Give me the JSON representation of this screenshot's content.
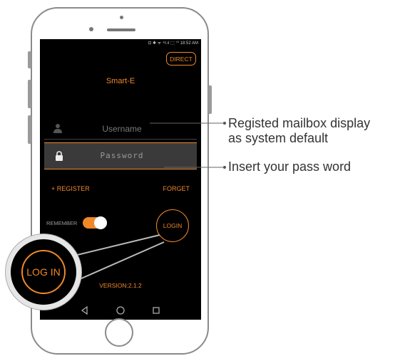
{
  "statusbar": {
    "text": "⊡ ✱ ᯤ ⁴ᵍ.ıl ⬚ ⁷⁰ 18:52 AM"
  },
  "app": {
    "direct_label": "DIRECT",
    "title": "Smart-E",
    "username_placeholder": "Username",
    "password_value": "Password",
    "register_label": "+ REGISTER",
    "forget_label": "FORGET",
    "remember_label": "REMEMBER",
    "remember_on": true,
    "login_label": "LOGIN",
    "version": "VERSION:2.1.2"
  },
  "zoom": {
    "login_label": "LOG IN"
  },
  "annotations": {
    "mailbox_line1": "Registed mailbox display",
    "mailbox_line2": "as system default",
    "password_note": "Insert your pass word"
  },
  "colors": {
    "accent": "#f0882a",
    "screen": "#000000",
    "field": "#3a3a3a"
  }
}
